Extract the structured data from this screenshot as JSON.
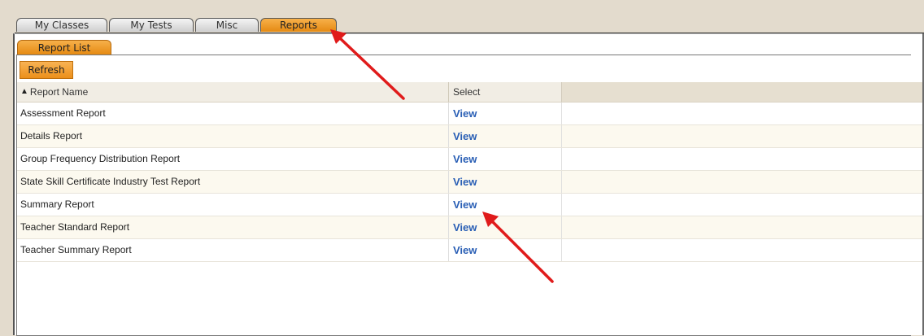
{
  "tabs": [
    {
      "label": "My Classes",
      "active": false
    },
    {
      "label": "My Tests",
      "active": false
    },
    {
      "label": "Misc",
      "active": false
    },
    {
      "label": "Reports",
      "active": true
    }
  ],
  "sub_tab": {
    "label": "Report List"
  },
  "toolbar": {
    "refresh_label": "Refresh"
  },
  "grid": {
    "columns": [
      {
        "label": "Report Name",
        "sort": "ascending",
        "sort_icon": "▲"
      },
      {
        "label": "Select"
      }
    ],
    "rows": [
      {
        "name": "Assessment Report",
        "action": "View"
      },
      {
        "name": "Details Report",
        "action": "View"
      },
      {
        "name": "Group Frequency Distribution Report",
        "action": "View"
      },
      {
        "name": "State Skill Certificate Industry Test Report",
        "action": "View"
      },
      {
        "name": "Summary Report",
        "action": "View"
      },
      {
        "name": "Teacher Standard Report",
        "action": "View"
      },
      {
        "name": "Teacher Summary Report",
        "action": "View"
      }
    ]
  },
  "colors": {
    "accent_orange": "#ec8f1a",
    "link_blue": "#2a5fb5",
    "annotation_red": "#e01b1b",
    "background": "#e3dbcd"
  },
  "annotations": [
    {
      "type": "arrow",
      "points_to": "Reports tab"
    },
    {
      "type": "arrow",
      "points_to": "Summary Report View link"
    }
  ]
}
